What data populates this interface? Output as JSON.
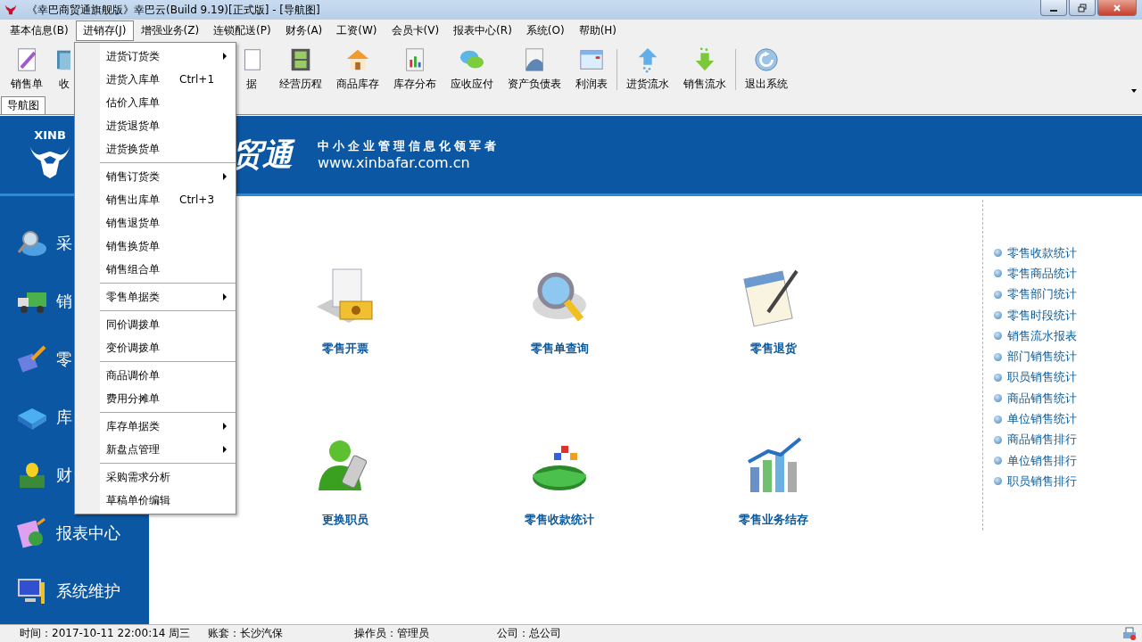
{
  "window": {
    "title": "《幸巴商贸通旗舰版》幸巴云(Build 9.19)[正式版] - [导航图]"
  },
  "menu_bar": [
    {
      "label": "基本信息(B)",
      "selected": false
    },
    {
      "label": "进销存(J)",
      "selected": true
    },
    {
      "label": "增强业务(Z)",
      "selected": false
    },
    {
      "label": "连锁配送(P)",
      "selected": false
    },
    {
      "label": "财务(A)",
      "selected": false
    },
    {
      "label": "工资(W)",
      "selected": false
    },
    {
      "label": "会员卡(V)",
      "selected": false
    },
    {
      "label": "报表中心(R)",
      "selected": false
    },
    {
      "label": "系统(O)",
      "selected": false
    },
    {
      "label": "帮助(H)",
      "selected": false
    }
  ],
  "dropdown": [
    {
      "kind": "item",
      "label": "进货订货类",
      "has_submenu": true
    },
    {
      "kind": "item",
      "label": "进货入库单",
      "shortcut": "Ctrl+1",
      "has_submenu": false
    },
    {
      "kind": "item",
      "label": "估价入库单",
      "has_submenu": false
    },
    {
      "kind": "item",
      "label": "进货退货单",
      "has_submenu": false
    },
    {
      "kind": "item",
      "label": "进货换货单",
      "has_submenu": false
    },
    {
      "kind": "separator"
    },
    {
      "kind": "item",
      "label": "销售订货类",
      "has_submenu": true
    },
    {
      "kind": "item",
      "label": "销售出库单",
      "shortcut": "Ctrl+3",
      "has_submenu": false
    },
    {
      "kind": "item",
      "label": "销售退货单",
      "has_submenu": false
    },
    {
      "kind": "item",
      "label": "销售换货单",
      "has_submenu": false
    },
    {
      "kind": "item",
      "label": "销售组合单",
      "has_submenu": false
    },
    {
      "kind": "separator"
    },
    {
      "kind": "item",
      "label": "零售单据类",
      "has_submenu": true
    },
    {
      "kind": "separator"
    },
    {
      "kind": "item",
      "label": "同价调拨单",
      "has_submenu": false
    },
    {
      "kind": "item",
      "label": "变价调拨单",
      "has_submenu": false
    },
    {
      "kind": "separator"
    },
    {
      "kind": "item",
      "label": "商品调价单",
      "has_submenu": false
    },
    {
      "kind": "item",
      "label": "费用分摊单",
      "has_submenu": false
    },
    {
      "kind": "separator"
    },
    {
      "kind": "item",
      "label": "库存单据类",
      "has_submenu": true
    },
    {
      "kind": "item",
      "label": "新盘点管理",
      "has_submenu": true
    },
    {
      "kind": "separator"
    },
    {
      "kind": "item",
      "label": "采购需求分析",
      "has_submenu": false
    },
    {
      "kind": "item",
      "label": "草稿单价编辑",
      "has_submenu": false
    }
  ],
  "toolbar": [
    {
      "kind": "button",
      "label": "销售单"
    },
    {
      "kind": "button",
      "label": "收"
    },
    {
      "kind": "gap"
    },
    {
      "kind": "button",
      "label": "据"
    },
    {
      "kind": "button",
      "label": "经营历程"
    },
    {
      "kind": "button",
      "label": "商品库存"
    },
    {
      "kind": "button",
      "label": "库存分布"
    },
    {
      "kind": "button",
      "label": "应收应付"
    },
    {
      "kind": "button",
      "label": "资产负债表"
    },
    {
      "kind": "button",
      "label": "利润表"
    },
    {
      "kind": "separator"
    },
    {
      "kind": "button",
      "label": "进货流水"
    },
    {
      "kind": "button",
      "label": "销售流水"
    },
    {
      "kind": "separator"
    },
    {
      "kind": "button",
      "label": "退出系统"
    }
  ],
  "tabs": [
    {
      "label": "导航图",
      "selected": true
    }
  ],
  "banner": {
    "logo_text": "XINB",
    "brand_text": "贸通",
    "slogan": "中小企业管理信息化领军者",
    "url": "www.xinbafar.com.cn"
  },
  "sidebar": {
    "items": [
      {
        "label": "采"
      },
      {
        "label": "销"
      },
      {
        "label": "零"
      },
      {
        "label": "库"
      },
      {
        "label": "财"
      },
      {
        "label": "报表中心"
      },
      {
        "label": "系统维护"
      }
    ]
  },
  "tiles": [
    {
      "label": "零售开票"
    },
    {
      "label": "零售单查询"
    },
    {
      "label": "零售退货"
    },
    {
      "label": "更换职员"
    },
    {
      "label": "零售收款统计"
    },
    {
      "label": "零售业务结存"
    }
  ],
  "links": [
    "零售收款统计",
    "零售商品统计",
    "零售部门统计",
    "零售时段统计",
    "销售流水报表",
    "部门销售统计",
    "职员销售统计",
    "商品销售统计",
    "单位销售统计",
    "商品销售排行",
    "单位销售排行",
    "职员销售排行"
  ],
  "status_bar": [
    "时间：2017-10-11 22:00:14 周三",
    "账套：长沙汽保",
    "操作员：管理员",
    "公司：总公司"
  ]
}
